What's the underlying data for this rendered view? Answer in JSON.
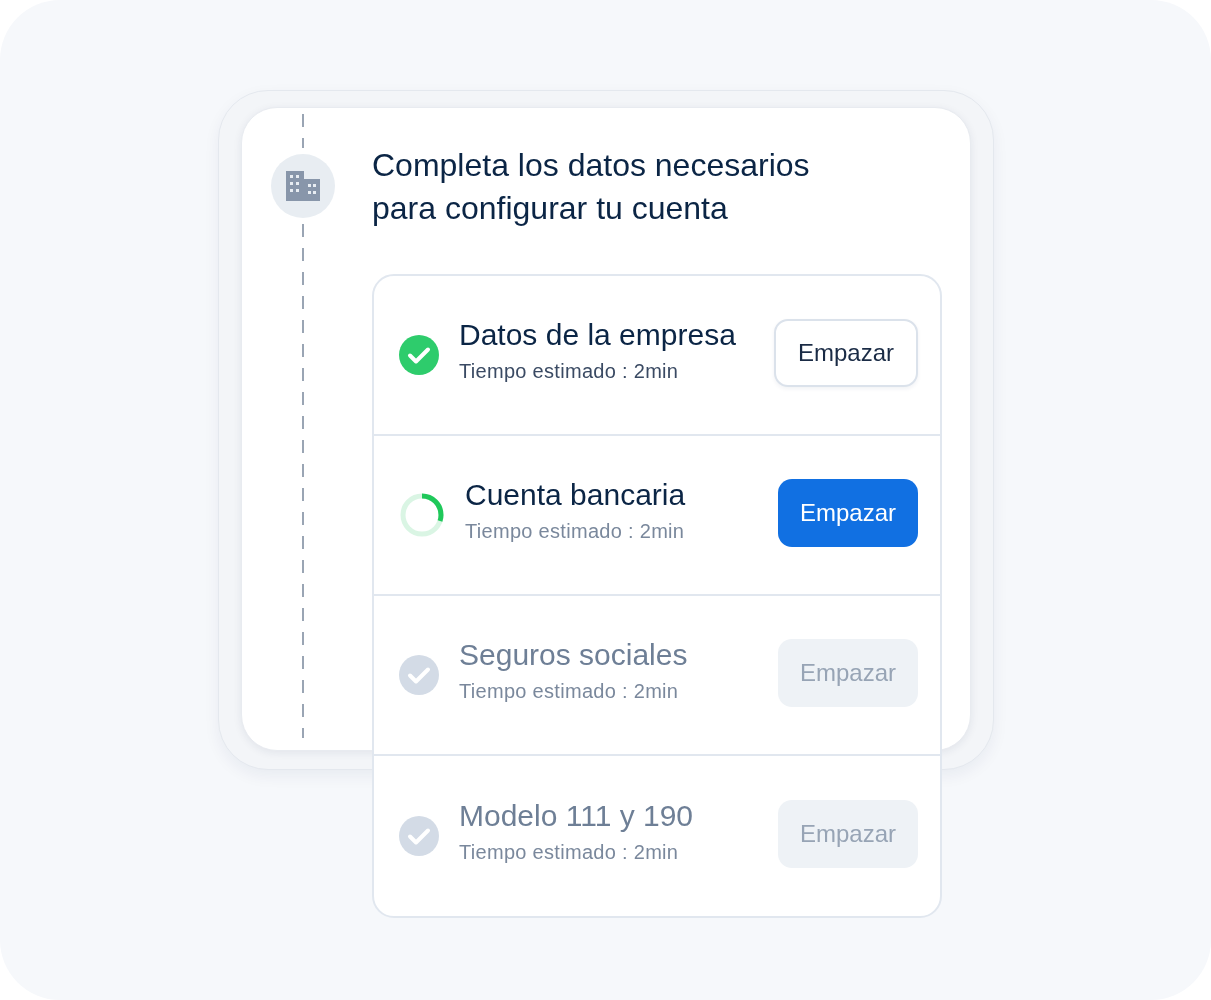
{
  "heading": "Completa los datos necesarios para configurar tu cuenta",
  "tasks": [
    {
      "title": "Datos de la empresa",
      "time": "Tiempo estimado : 2min",
      "kind": "done",
      "button": {
        "label": "Empazar",
        "kind": "outline"
      }
    },
    {
      "title": "Cuenta bancaria",
      "time": "Tiempo estimado : 2min",
      "kind": "progress",
      "button": {
        "label": "Empazar",
        "kind": "primary"
      }
    },
    {
      "title": "Seguros sociales",
      "time": "Tiempo estimado : 2min",
      "kind": "pending",
      "button": {
        "label": "Empazar",
        "kind": "disabled"
      }
    },
    {
      "title": "Modelo 111 y 190",
      "time": "Tiempo estimado : 2min",
      "kind": "pending",
      "button": {
        "label": "Empazar",
        "kind": "disabled"
      }
    }
  ]
}
